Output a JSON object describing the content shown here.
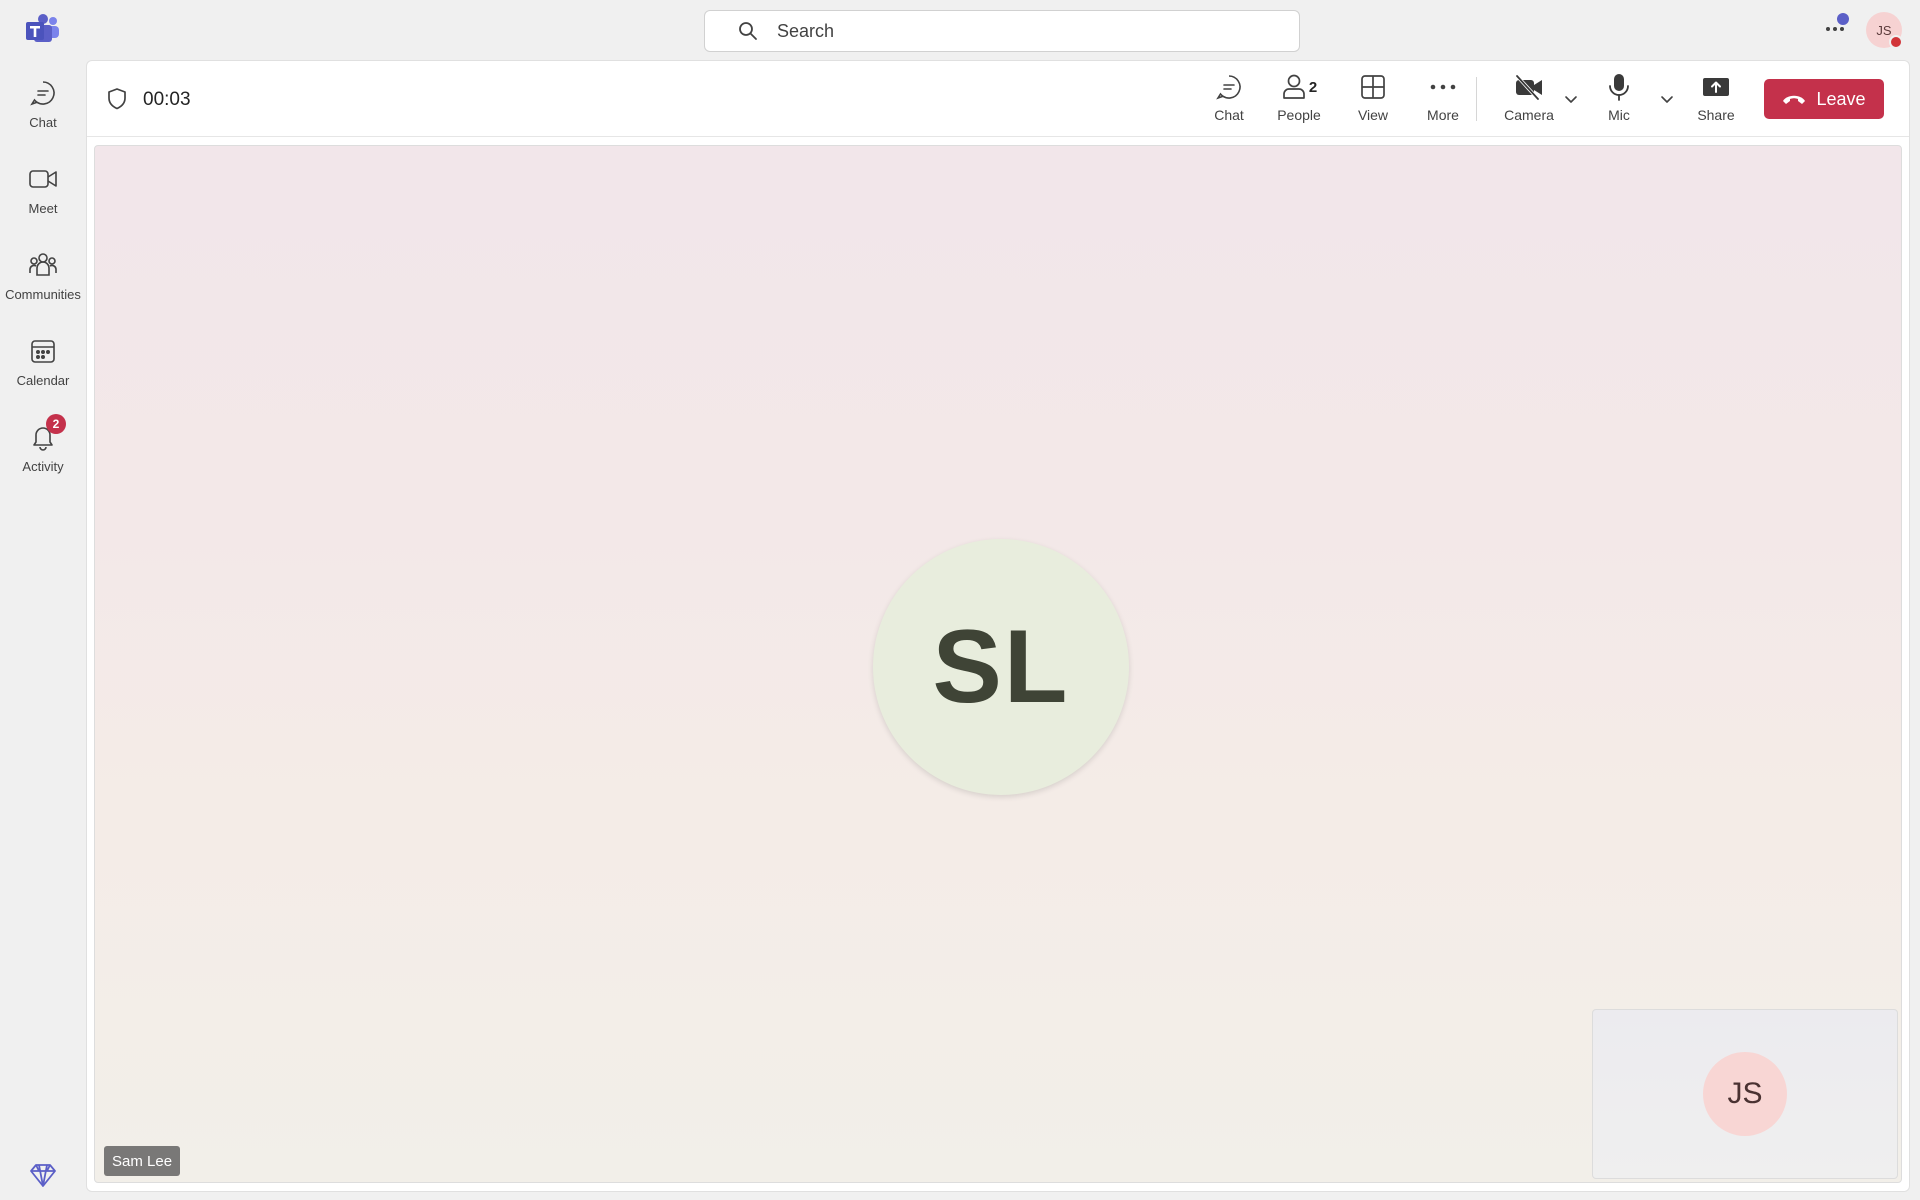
{
  "app": {
    "accent": "#5b5fc7",
    "danger": "#c4314b"
  },
  "rail": {
    "items": [
      {
        "label": "Chat",
        "icon": "chat-bubble-icon"
      },
      {
        "label": "Meet",
        "icon": "video-camera-icon"
      },
      {
        "label": "Communities",
        "icon": "people-group-icon"
      },
      {
        "label": "Calendar",
        "icon": "calendar-icon"
      },
      {
        "label": "Activity",
        "icon": "bell-icon",
        "badge": "2"
      }
    ]
  },
  "search": {
    "placeholder": "Search"
  },
  "user": {
    "initials": "JS"
  },
  "meeting": {
    "timer": "00:03",
    "toolbar": {
      "chat": "Chat",
      "people": "People",
      "people_count": "2",
      "view": "View",
      "more": "More",
      "camera": "Camera",
      "mic": "Mic",
      "share": "Share",
      "leave": "Leave"
    },
    "participant": {
      "initials": "SL",
      "name": "Sam Lee"
    },
    "self_view": {
      "initials": "JS"
    }
  }
}
